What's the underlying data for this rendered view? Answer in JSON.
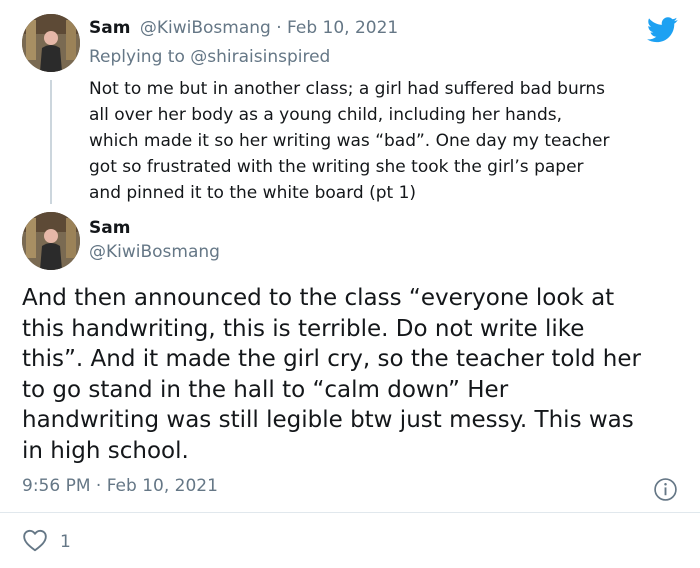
{
  "reply_tweet": {
    "author_name": "Sam",
    "author_handle": "@KiwiBosmang",
    "separator": "·",
    "date": "Feb 10, 2021",
    "replying_prefix": "Replying to ",
    "replying_to": "@shiraisinspired",
    "text_lines": [
      "Not to me but in another class; a girl had suffered bad burns",
      "all over her body as a young child, including her hands,",
      "which made it so her writing was “bad”. One day my teacher",
      "got so frustrated with the writing she took the girl’s paper",
      "and pinned it to the white board (pt 1)"
    ]
  },
  "main_tweet": {
    "author_name": "Sam",
    "author_handle": "@KiwiBosmang",
    "text_lines": [
      "And then announced to the class “everyone look at",
      "this handwriting, this is terrible. Do not write like",
      "this”. And it made the girl cry, so the teacher told her",
      "to go stand in the hall to “calm down” Her",
      "handwriting was still legible btw just messy. This was",
      "in high school."
    ],
    "timestamp": "9:56 PM · Feb 10, 2021",
    "like_count": "1"
  },
  "icons": {
    "brand": "twitter-bird-icon",
    "info": "info-icon",
    "like": "heart-icon"
  },
  "colors": {
    "brand_blue": "#1da1f2",
    "muted_text": "#657786",
    "divider": "#e1e8ed"
  }
}
